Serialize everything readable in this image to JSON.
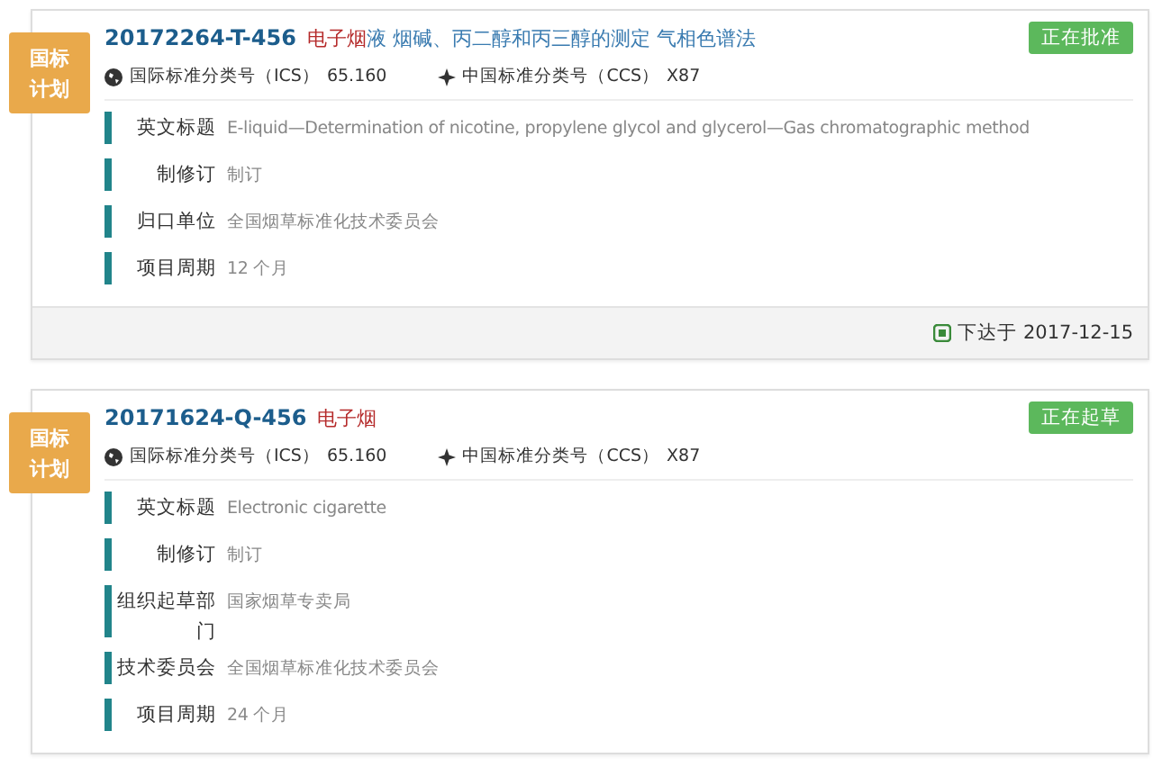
{
  "cards": [
    {
      "badge": "国标计划",
      "code": "20172264-T-456",
      "title_highlight": "电子烟",
      "title_rest": "液 烟碱、丙二醇和丙三醇的测定 气相色谱法",
      "status": "正在批准",
      "ics_label": "国际标准分类号（ICS）",
      "ics_value": "65.160",
      "ccs_label": "中国标准分类号（CCS）",
      "ccs_value": "X87",
      "fields": [
        {
          "label": "英文标题",
          "value": "E-liquid—Determination of nicotine, propylene glycol and glycerol—Gas chromatographic method"
        },
        {
          "label": "制修订",
          "value": "制订"
        },
        {
          "label": "归口单位",
          "value": "全国烟草标准化技术委员会"
        },
        {
          "label": "项目周期",
          "value": "12 个月"
        }
      ],
      "footer": "下达于 2017-12-15"
    },
    {
      "badge": "国标计划",
      "code": "20171624-Q-456",
      "title_highlight": "电子烟",
      "status": "正在起草",
      "ics_label": "国际标准分类号（ICS）",
      "ics_value": "65.160",
      "ccs_label": "中国标准分类号（CCS）",
      "ccs_value": "X87",
      "fields": [
        {
          "label": "英文标题",
          "value": "Electronic cigarette"
        },
        {
          "label": "制修订",
          "value": "制订"
        },
        {
          "label": "组织起草部门",
          "value": "国家烟草专卖局"
        },
        {
          "label": "技术委员会",
          "value": "全国烟草标准化技术委员会"
        },
        {
          "label": "项目周期",
          "value": "24 个月"
        }
      ]
    }
  ]
}
